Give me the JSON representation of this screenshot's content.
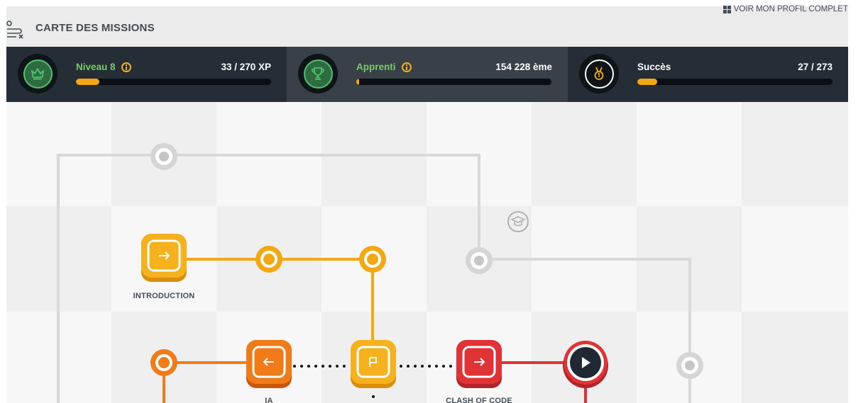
{
  "header": {
    "title": "CARTE DES MISSIONS",
    "profile_link": "VOIR MON PROFIL COMPLET"
  },
  "stats": [
    {
      "label": "Niveau 8",
      "value": "33 / 270 XP",
      "progress": 0.12,
      "icon": "crown-icon",
      "label_color": "#79c96b",
      "has_info": true
    },
    {
      "label": "Apprenti",
      "value": "154 228 ème",
      "progress": 0.015,
      "icon": "trophy-icon",
      "label_color": "#79c96b",
      "has_info": true
    },
    {
      "label": "Succès",
      "value": "27 / 273",
      "progress": 0.1,
      "icon": "medal-icon",
      "label_color": "#ffffff",
      "has_info": false
    }
  ],
  "map": {
    "nodes": {
      "introduction": {
        "label": "INTRODUCTION",
        "icon": "arrow-right-icon",
        "color": "#f3a813"
      },
      "ia": {
        "label": "IA",
        "icon": "arrow-left-icon",
        "color": "#f07b18"
      },
      "flag": {
        "label": "",
        "icon": "flag-icon",
        "color": "#f3a813"
      },
      "clash_of_code": {
        "label": "CLASH OF CODE",
        "icon": "arrow-right-icon",
        "color": "#e13236"
      },
      "play": {
        "label": "",
        "icon": "play-icon",
        "color": "#1f2833"
      },
      "graduation": {
        "label": "",
        "icon": "graduation-cap-icon",
        "color": "#a8a8a8"
      }
    }
  },
  "colors": {
    "accent": "#f3a813",
    "dark_bar": "#252e37",
    "orange": "#f07b18",
    "red": "#e13236",
    "gray_path": "#d7d7d7"
  }
}
